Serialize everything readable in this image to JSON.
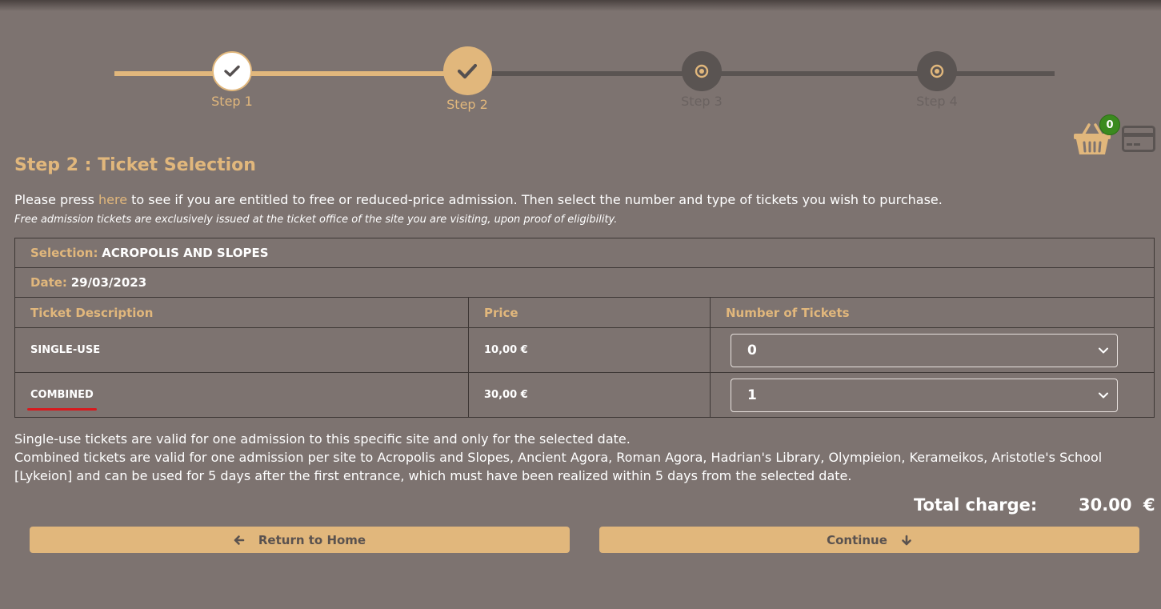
{
  "stepper": {
    "steps": [
      {
        "label": "Step 1",
        "state": "completed"
      },
      {
        "label": "Step 2",
        "state": "current"
      },
      {
        "label": "Step 3",
        "state": "upcoming"
      },
      {
        "label": "Step 4",
        "state": "upcoming"
      }
    ]
  },
  "cart": {
    "count": "0",
    "icon": "basket-icon"
  },
  "payment": {
    "icon": "credit-card-icon"
  },
  "page": {
    "title": "Step 2 : Ticket Selection",
    "intro_before": "Please press ",
    "intro_link": "here",
    "intro_after": " to see if you are entitled to free or reduced-price admission. Then select the number and type of tickets you wish to purchase.",
    "note": "Free admission tickets are exclusively issued at the ticket office of the site you are visiting, upon proof of eligibility."
  },
  "table": {
    "selection_label": "Selection:",
    "selection_value": "ACROPOLIS AND SLOPES",
    "date_label": "Date:",
    "date_value": "29/03/2023",
    "headers": {
      "description": "Ticket Description",
      "price": "Price",
      "number": "Number of Tickets"
    },
    "rows": [
      {
        "description": "SINGLE-USE",
        "price": "10,00 €",
        "quantity": "0"
      },
      {
        "description": "COMBINED",
        "price": "30,00 €",
        "quantity": "1"
      }
    ]
  },
  "info": {
    "line1": "Single-use tickets are valid for one admission to this specific site and only for the selected date.",
    "line2": "Combined tickets are valid for one admission per site to Acropolis and Slopes, Ancient Agora, Roman Agora, Hadrian's Library, Olympieion, Kerameikos, Aristotle's School [Lykeion] and can be used for 5 days after the first entrance, which must have been realized within 5 days from the selected date."
  },
  "total": {
    "label": "Total charge:",
    "value": "30.00  €"
  },
  "buttons": {
    "home": "Return to Home",
    "continue": "Continue"
  },
  "colors": {
    "accent": "#e1b77c",
    "background": "#7d7370",
    "inactive": "#5a5452",
    "badge": "#3b8a1f",
    "highlight": "#d8191d"
  }
}
